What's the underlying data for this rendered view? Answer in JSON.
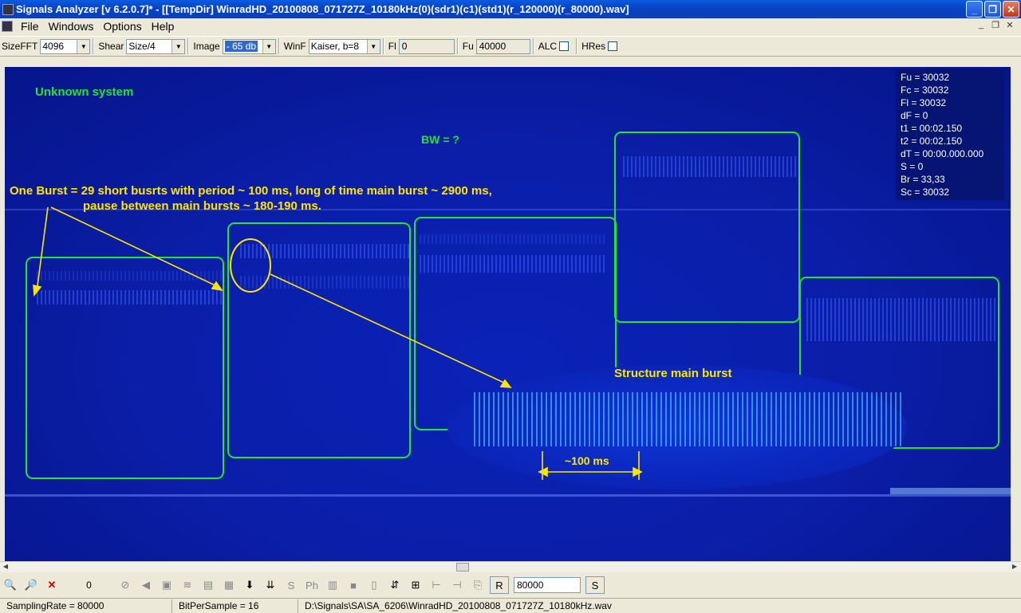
{
  "window": {
    "title": "Signals Analyzer [v 6.2.0.7]* - [[TempDir] WinradHD_20100808_071727Z_10180kHz(0)(sdr1)(c1)(std1)(r_120000)(r_80000).wav]",
    "minimize": "_",
    "maximize": "❐",
    "close": "✕"
  },
  "menu": {
    "items": [
      "File",
      "Windows",
      "Options",
      "Help"
    ],
    "mdi_controls": [
      "_",
      "❐",
      "✕"
    ]
  },
  "toolbar": {
    "sizefft_label": "SizeFFT",
    "sizefft_value": "4096",
    "shear_label": "Shear",
    "shear_value": "Size/4",
    "image_label": "Image",
    "image_value": "- 65 db",
    "winf_label": "WinF",
    "winf_value": "Kaiser, b=8",
    "fl_label": "Fl",
    "fl_value": "0",
    "fu_label": "Fu",
    "fu_value": "40000",
    "alc_label": "ALC",
    "hres_label": "HRes"
  },
  "readout": [
    "Fu = 30032",
    "Fc = 30032",
    "Fl = 30032",
    "dF = 0",
    "t1 = 00:02.150",
    "t2 = 00:02.150",
    "dT = 00:00.000.000",
    "S = 0",
    "Br = 33,33",
    "Sc = 30032"
  ],
  "annotations": {
    "unknown_system": "Unknown system",
    "bw": "BW = ?",
    "one_burst_line1": "One Burst = 29 short busrts with period ~ 100 ms, long of time main burst ~ 2900 ms,",
    "one_burst_line2": "pause between main bursts ~ 180-190 ms.",
    "structure": "Structure main burst",
    "period": "~100 ms"
  },
  "colors": {
    "annotation_yellow": "#ffe600",
    "annotation_green": "#22e62a",
    "box_green": "#22e62a"
  },
  "bottombar": {
    "counter": "0",
    "r_button": "R",
    "rate_value": "80000",
    "s_button": "S"
  },
  "status": {
    "sampling_rate": "SamplingRate = 80000",
    "bits": "BitPerSample = 16",
    "path": "D:\\Signals\\SA\\SA_6206\\WinradHD_20100808_071727Z_10180kHz.wav"
  }
}
